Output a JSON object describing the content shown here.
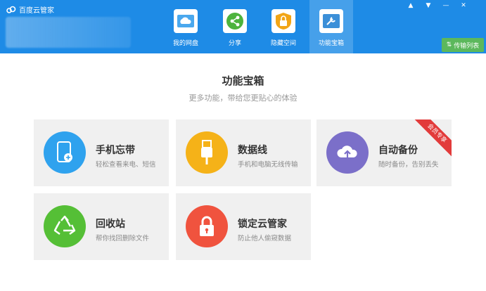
{
  "app": {
    "title": "百度云管家"
  },
  "window_controls": {
    "pin": "▲",
    "menu": "▼",
    "minimize": "—",
    "close": "✕"
  },
  "nav": {
    "tabs": [
      {
        "label": "我的网盘",
        "icon": "cloud-icon"
      },
      {
        "label": "分享",
        "icon": "share-icon"
      },
      {
        "label": "隐藏空间",
        "icon": "lock-icon"
      },
      {
        "label": "功能宝箱",
        "icon": "wrench-icon",
        "active": true
      }
    ]
  },
  "transfer_button": {
    "label": "传输列表"
  },
  "main": {
    "title": "功能宝箱",
    "subtitle": "更多功能，带给您更贴心的体验"
  },
  "cards": [
    {
      "title": "手机忘带",
      "desc": "轻松查看来电、短信",
      "color": "#2fa2ee",
      "icon": "phone-icon"
    },
    {
      "title": "数据线",
      "desc": "手机和电脑无线传输",
      "color": "#f5b218",
      "icon": "usb-icon"
    },
    {
      "title": "自动备份",
      "desc": "随时备份，告别丢失",
      "color": "#7b6fc9",
      "icon": "cloud-upload-icon",
      "badge": "会员专享"
    },
    {
      "title": "回收站",
      "desc": "帮你找回删除文件",
      "color": "#55bf36",
      "icon": "recycle-icon"
    },
    {
      "title": "锁定云管家",
      "desc": "防止他人偷窥数据",
      "color": "#f0533e",
      "icon": "lock-icon"
    }
  ],
  "colors": {
    "header": "#1e8be6",
    "transfer": "#5cb85c",
    "ribbon": "#e23b3b"
  }
}
